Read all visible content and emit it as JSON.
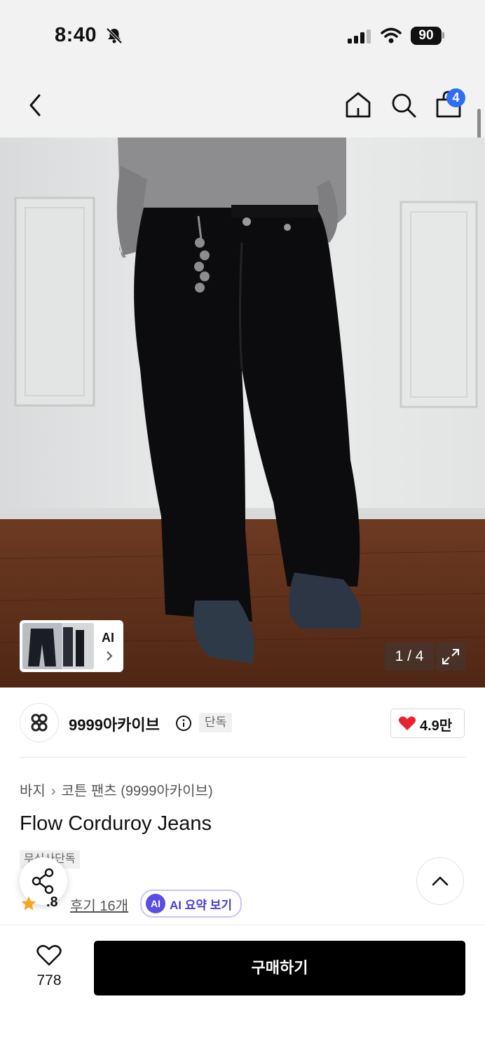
{
  "status_bar": {
    "time": "8:40",
    "battery": "90",
    "icons": [
      "bell-slash-icon",
      "cellular-signal-icon",
      "wifi-icon",
      "battery-icon"
    ]
  },
  "nav": {
    "icons": [
      "back-chevron-icon",
      "home-icon",
      "search-icon",
      "shopping-bag-icon"
    ],
    "cart_count": "4"
  },
  "gallery": {
    "thumb_label": "AI",
    "counter": "1 / 4",
    "thumb_icons": [
      "chevron-right-icon"
    ],
    "expand_icon": "expand-icon"
  },
  "brand": {
    "name": "9999아카이브",
    "exclusive": "단독",
    "like_count": "4.9만",
    "icons": [
      "brand-logo-icon",
      "info-icon",
      "heart-filled-icon"
    ]
  },
  "product": {
    "breadcrumb": [
      "바지",
      "코튼 팬츠 (9999아카이브)"
    ],
    "title": "Flow Corduroy Jeans",
    "tag": "무신사단독",
    "rating": "4.8",
    "rating_visible": ".8",
    "reviews": "후기 16개",
    "ai_badge": "AI",
    "ai_summary": "AI 요약 보기"
  },
  "floating": {
    "icons": [
      "share-icon",
      "chevron-up-icon"
    ]
  },
  "bottom_bar": {
    "wish_count": "778",
    "buy_label": "구매하기",
    "icons": [
      "heart-outline-icon"
    ]
  },
  "colors": {
    "accent_blue": "#2f6df6",
    "heart_red": "#e8232f",
    "star_orange": "#f5a623",
    "ai_purple": "#5b4ee3",
    "buy_button": "#000000"
  }
}
